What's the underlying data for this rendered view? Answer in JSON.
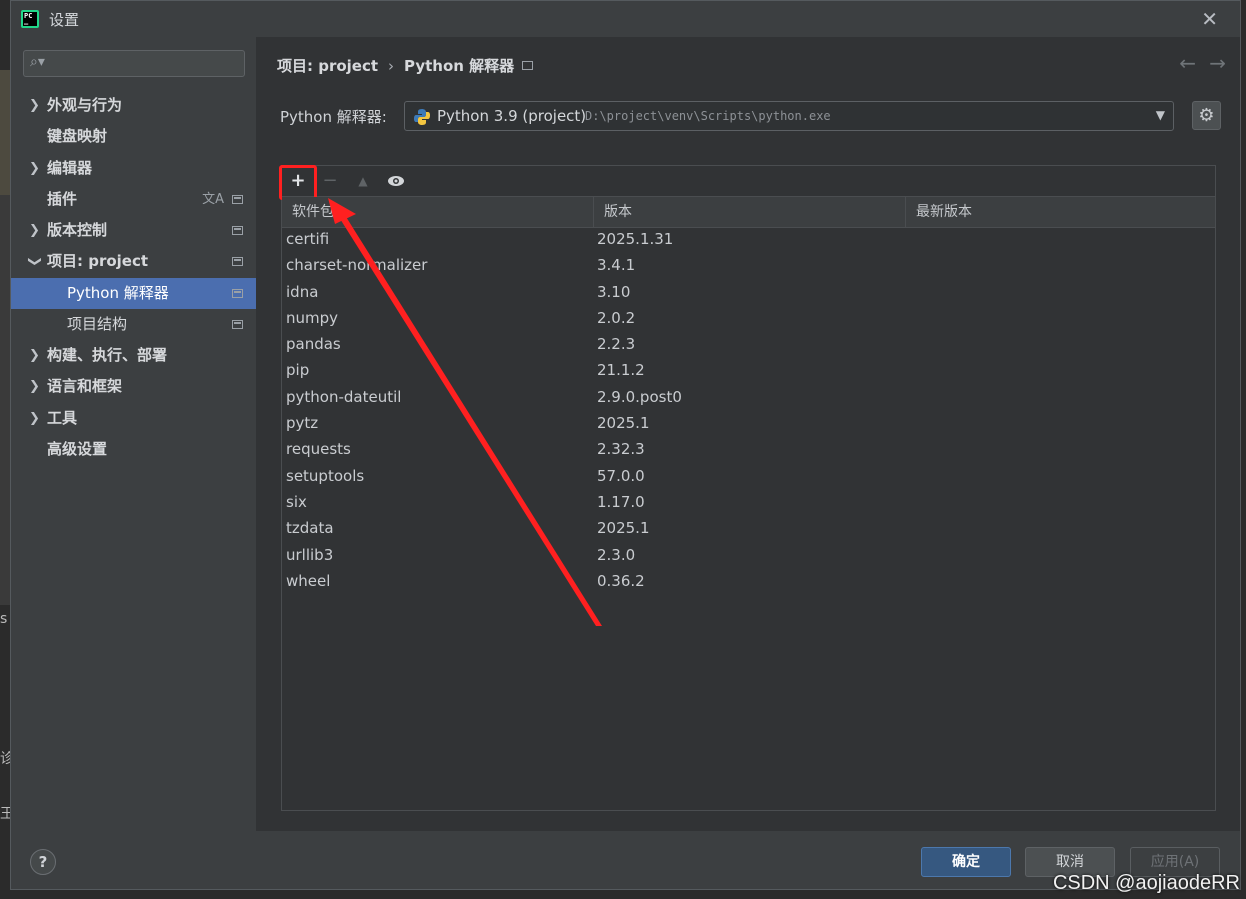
{
  "window": {
    "title": "设置"
  },
  "background": {
    "chars": [
      "s",
      "诊",
      "王"
    ]
  },
  "sidebar": {
    "search_placeholder": "",
    "items": [
      {
        "label": "外观与行为",
        "expandable": true,
        "expanded": false
      },
      {
        "label": "键盘映射",
        "expandable": false
      },
      {
        "label": "编辑器",
        "expandable": true,
        "expanded": false
      },
      {
        "label": "插件",
        "expandable": false
      },
      {
        "label": "版本控制",
        "expandable": true,
        "expanded": false
      },
      {
        "label": "项目: project",
        "expandable": true,
        "expanded": true
      },
      {
        "label": "Python 解释器",
        "sub": true,
        "selected": true
      },
      {
        "label": "项目结构",
        "sub": true
      },
      {
        "label": "构建、执行、部署",
        "expandable": true,
        "expanded": false
      },
      {
        "label": "语言和框架",
        "expandable": true,
        "expanded": false
      },
      {
        "label": "工具",
        "expandable": true,
        "expanded": false
      },
      {
        "label": "高级设置",
        "expandable": false
      }
    ]
  },
  "content": {
    "breadcrumb": {
      "parent": "项目: project",
      "sep": "›",
      "current": "Python 解释器"
    },
    "interpreter_label": "Python 解释器:",
    "interpreter": {
      "name": "Python 3.9 (project)",
      "path": "D:\\project\\venv\\Scripts\\python.exe"
    },
    "table": {
      "columns": [
        "软件包",
        "版本",
        "最新版本"
      ],
      "rows": [
        {
          "name": "certifi",
          "version": "2025.1.31"
        },
        {
          "name": "charset-normalizer",
          "version": "3.4.1"
        },
        {
          "name": "idna",
          "version": "3.10"
        },
        {
          "name": "numpy",
          "version": "2.0.2"
        },
        {
          "name": "pandas",
          "version": "2.2.3"
        },
        {
          "name": "pip",
          "version": "21.1.2"
        },
        {
          "name": "python-dateutil",
          "version": "2.9.0.post0"
        },
        {
          "name": "pytz",
          "version": "2025.1"
        },
        {
          "name": "requests",
          "version": "2.32.3"
        },
        {
          "name": "setuptools",
          "version": "57.0.0"
        },
        {
          "name": "six",
          "version": "1.17.0"
        },
        {
          "name": "tzdata",
          "version": "2025.1"
        },
        {
          "name": "urllib3",
          "version": "2.3.0"
        },
        {
          "name": "wheel",
          "version": "0.36.2"
        }
      ]
    }
  },
  "footer": {
    "ok": "确定",
    "cancel": "取消",
    "apply": "应用(A)"
  },
  "watermark": "CSDN @aojiaodeRR",
  "colors": {
    "accent": "#4b6eaf",
    "highlight": "#ff2020",
    "ok_button": "#365880"
  }
}
